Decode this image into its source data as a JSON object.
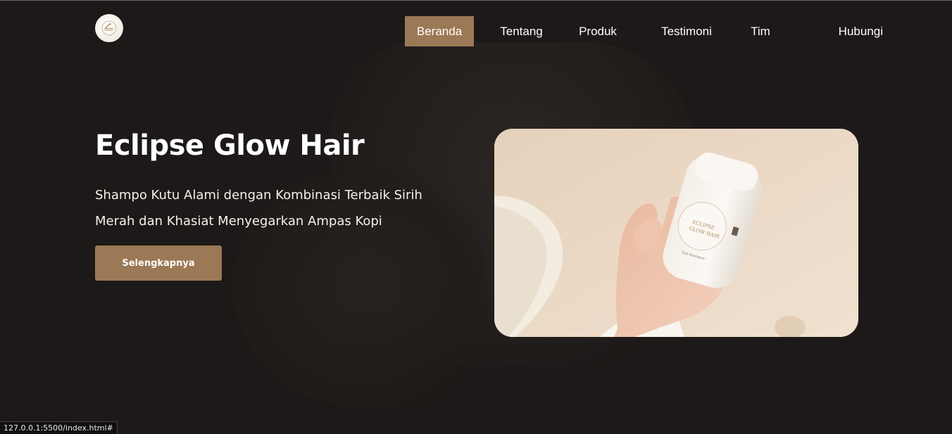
{
  "brand": {
    "logo_icon": "eclipse-glow-hair-logo-icon"
  },
  "nav": {
    "items": [
      {
        "label": "Beranda",
        "active": true
      },
      {
        "label": "Tentang",
        "active": false
      },
      {
        "label": "Produk",
        "active": false
      },
      {
        "label": "Testimoni",
        "active": false
      },
      {
        "label": "Tim",
        "active": false
      },
      {
        "label": "Hubungi",
        "active": false
      }
    ]
  },
  "hero": {
    "title": "Eclipse Glow Hair",
    "subtitle": "Shampo Kutu Alami dengan Kombinasi Terbaik Sirih Merah dan Khasiat Menyegarkan Ampas Kopi",
    "cta_label": "Selengkapnya",
    "image_alt": "product-photo-hand-holding-bottle"
  },
  "status_bar": {
    "url": "127.0.0.1:5500/index.html#"
  },
  "colors": {
    "accent": "#9c7956",
    "background": "#1c1918",
    "text": "#ffffff",
    "photo_background": "#e9d6c1"
  }
}
